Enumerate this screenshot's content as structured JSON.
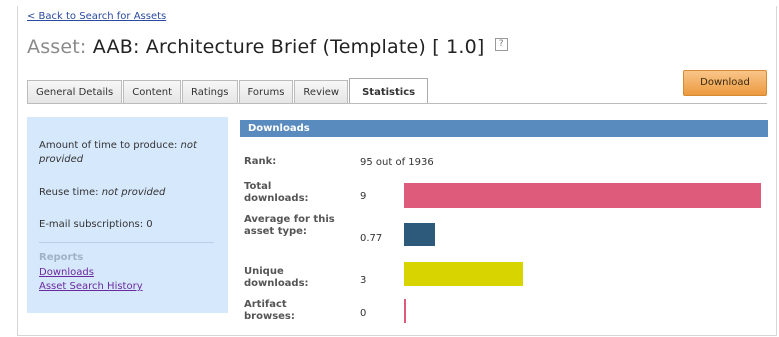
{
  "nav": {
    "back_link": "< Back to Search for Assets"
  },
  "asset": {
    "prefix": "Asset:",
    "title": "AAB: Architecture Brief (Template) [ 1.0]",
    "help_glyph": "?"
  },
  "tabs": [
    {
      "label": "General Details",
      "active": false
    },
    {
      "label": "Content",
      "active": false
    },
    {
      "label": "Ratings",
      "active": false
    },
    {
      "label": "Forums",
      "active": false
    },
    {
      "label": "Review",
      "active": false
    },
    {
      "label": "Statistics",
      "active": true
    }
  ],
  "download_button": "Download",
  "sidebar": {
    "time_to_produce_label": "Amount of time to produce:",
    "time_to_produce_value": "not provided",
    "reuse_label": "Reuse time:",
    "reuse_value": "not provided",
    "subscriptions": "E-mail subscriptions: 0",
    "reports_label": "Reports",
    "links": [
      "Downloads",
      "Asset Search History"
    ]
  },
  "downloads": {
    "header": "Downloads",
    "rank_label": "Rank:",
    "rank_value": "95 out of 1936",
    "stats": [
      {
        "label": "Total downloads:",
        "value": "9",
        "amount": 9,
        "color": "#df5b7b"
      },
      {
        "label": "Average for this asset type:",
        "value": "0.77",
        "amount": 0.77,
        "color": "#2d5a7b"
      },
      {
        "label": "Unique downloads:",
        "value": "3",
        "amount": 3,
        "color": "#d8d400"
      },
      {
        "label": "Artifact browses:",
        "value": "0",
        "amount": 0,
        "color": "#df5b7b"
      }
    ]
  },
  "colors": {
    "section_header": "#5a8bbf",
    "sidebar_bg": "#d6e8fb",
    "download_button": "#ec9a3e",
    "link": "#2a4aa0"
  }
}
